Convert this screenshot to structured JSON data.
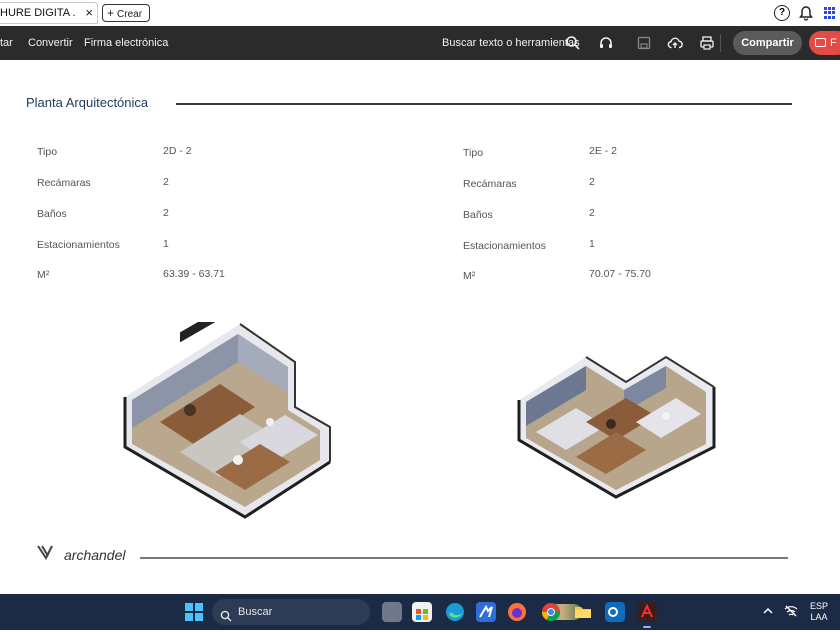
{
  "tabs": {
    "active_title": "HURE DIGITA ...",
    "close_glyph": "×",
    "new_tab_label": "Crear"
  },
  "toolbar": {
    "item_truncated": "tar",
    "convert": "Convertir",
    "sign": "Firma electrónica",
    "search": "Buscar texto o herramientas",
    "share": "Compartir",
    "red_button_label": "F"
  },
  "document": {
    "section_title": "Planta Arquitectónica",
    "labels": {
      "tipo": "Tipo",
      "recamaras": "Recámaras",
      "banos": "Baños",
      "estacionamientos": "Estacionamientos",
      "m2": "M²"
    },
    "units": [
      {
        "tipo": "2D - 2",
        "recamaras": "2",
        "banos": "2",
        "estacionamientos": "1",
        "m2": "63.39 - 63.71"
      },
      {
        "tipo": "2E - 2",
        "recamaras": "2",
        "banos": "2",
        "estacionamientos": "1",
        "m2": "70.07 - 75.70"
      }
    ],
    "footer_logo_text": "archandel"
  },
  "taskbar": {
    "search_placeholder": "Buscar",
    "language_line1": "ESP",
    "language_line2": "LAA"
  },
  "icons": [
    "help-icon",
    "bell-icon",
    "apps-grid-icon",
    "search-icon",
    "headphones-icon",
    "save-icon",
    "upload-icon",
    "print-icon",
    "windows-icon",
    "edge-icon",
    "firefox-icon",
    "chrome-icon",
    "folder-icon",
    "outlook-icon",
    "acrobat-icon"
  ],
  "colors": {
    "toolbar_bg": "#2b2b2b",
    "share_bg": "#5a5a5a",
    "accent_red": "#e44b45",
    "title_blue": "#1d3a5a",
    "taskbar_bg": "#1c2b45"
  }
}
